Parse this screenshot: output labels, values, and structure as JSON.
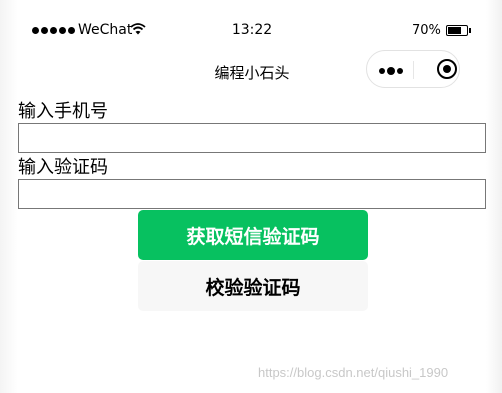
{
  "status_bar": {
    "carrier": "WeChat",
    "time": "13:22",
    "battery": "70%",
    "battery_level": 0.7,
    "icons": [
      "signal-dots-icon",
      "wifi-icon",
      "battery-icon"
    ]
  },
  "nav": {
    "title": "编程小石头",
    "capsule_icons": [
      "more-dots-icon",
      "close-target-icon"
    ]
  },
  "form": {
    "phone_label": "输入手机号",
    "phone_value": "",
    "code_label": "输入验证码",
    "code_value": "",
    "get_code_button": "获取短信验证码",
    "verify_button": "校验验证码"
  },
  "colors": {
    "primary_button": "#07c160",
    "default_button": "#f7f7f7"
  },
  "watermark": "https://blog.csdn.net/qiushi_1990"
}
